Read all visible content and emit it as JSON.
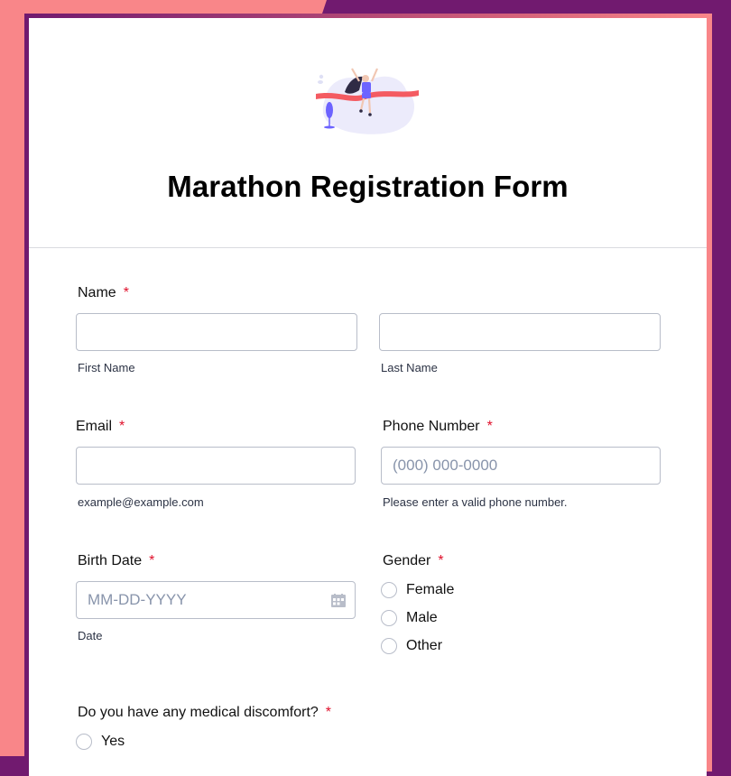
{
  "form": {
    "title": "Marathon Registration Form",
    "hero_image": "runner-crossing-finish-line-illustration",
    "colors": {
      "pink": "#f98689",
      "purple": "#711a6f",
      "required": "#e0102b"
    }
  },
  "fields": {
    "name": {
      "label": "Name",
      "required_mark": "*",
      "first": {
        "value": "",
        "sublabel": "First Name"
      },
      "last": {
        "value": "",
        "sublabel": "Last Name"
      }
    },
    "email": {
      "label": "Email",
      "required_mark": "*",
      "value": "",
      "sublabel": "example@example.com"
    },
    "phone": {
      "label": "Phone Number",
      "required_mark": "*",
      "placeholder": "(000) 000-0000",
      "sublabel": "Please enter a valid phone number."
    },
    "birth_date": {
      "label": "Birth Date",
      "required_mark": "*",
      "placeholder": "MM-DD-YYYY",
      "sublabel": "Date",
      "icon": "calendar-icon"
    },
    "gender": {
      "label": "Gender",
      "required_mark": "*",
      "options": [
        "Female",
        "Male",
        "Other"
      ]
    },
    "medical": {
      "label": "Do you have any medical discomfort?",
      "required_mark": "*",
      "options": [
        "Yes"
      ]
    }
  }
}
